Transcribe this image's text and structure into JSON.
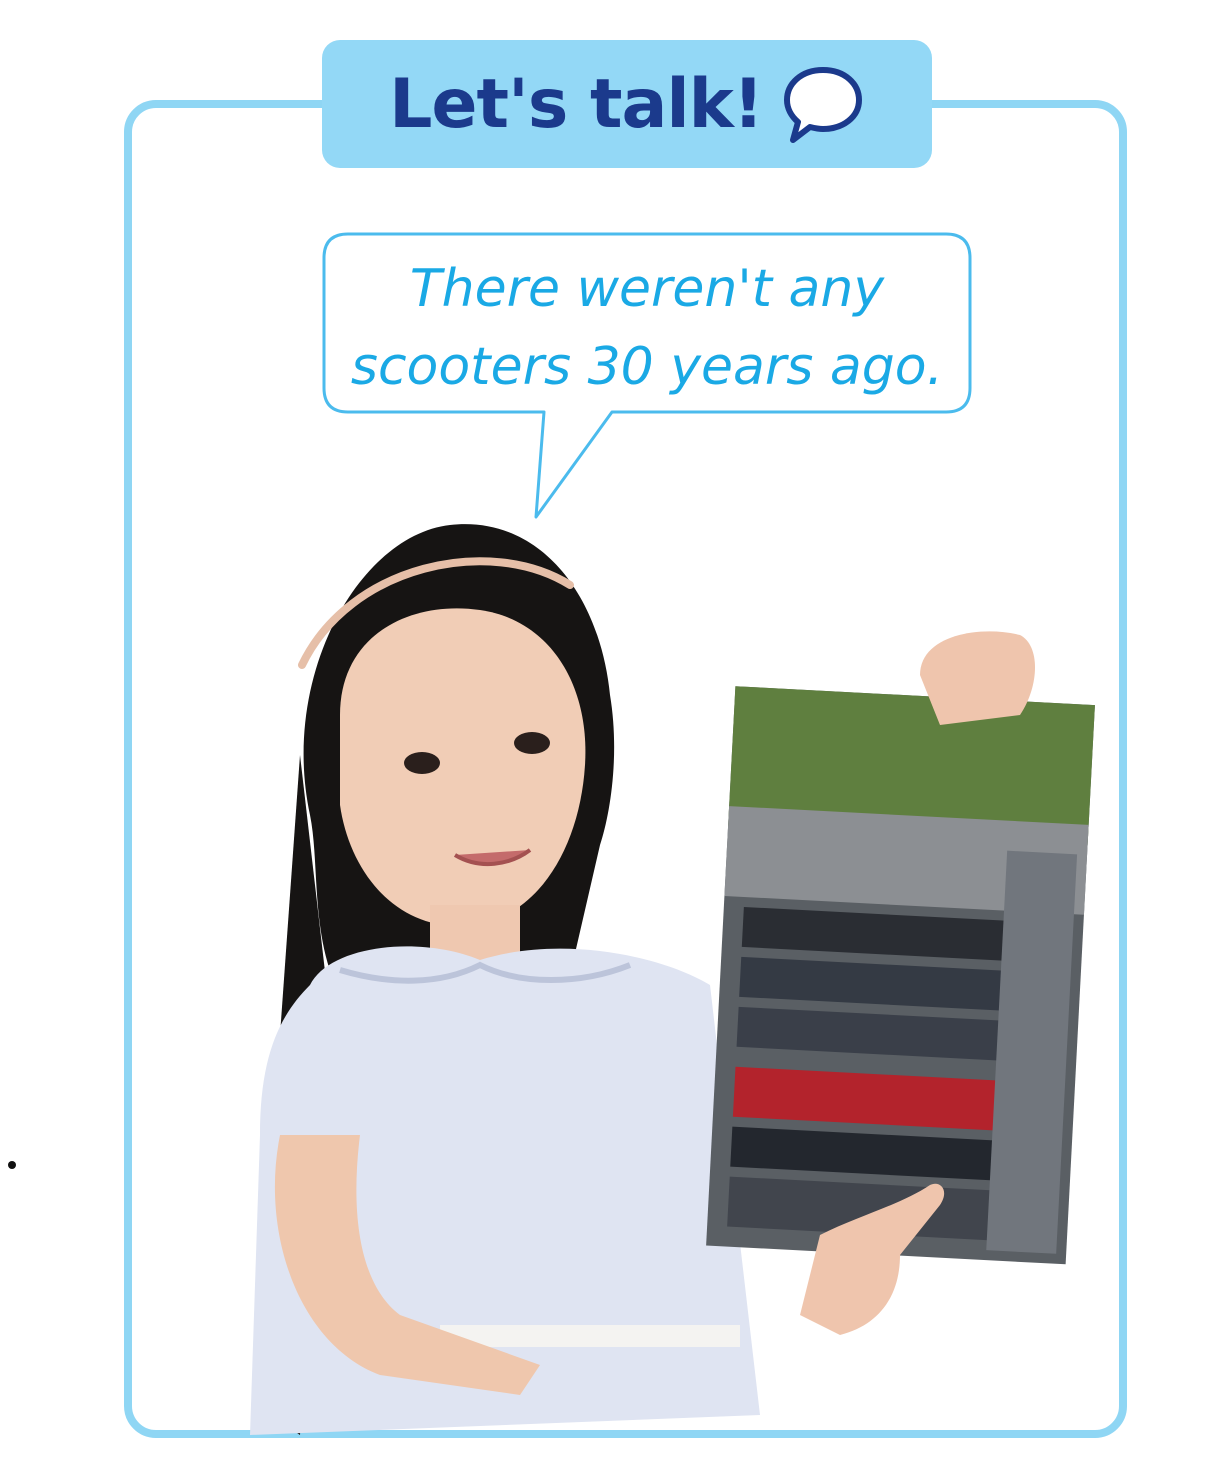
{
  "header": {
    "title": "Let's talk!",
    "icon": "speech-bubble-icon"
  },
  "speech_bubble": {
    "line1": "There weren't any",
    "line2": "scooters 30 years ago."
  },
  "colors": {
    "frame": "#8fd6f4",
    "header_bg": "#93d8f6",
    "header_text": "#1b3a8c",
    "bubble_border": "#4bbbed",
    "bubble_text": "#1aa9e5"
  }
}
